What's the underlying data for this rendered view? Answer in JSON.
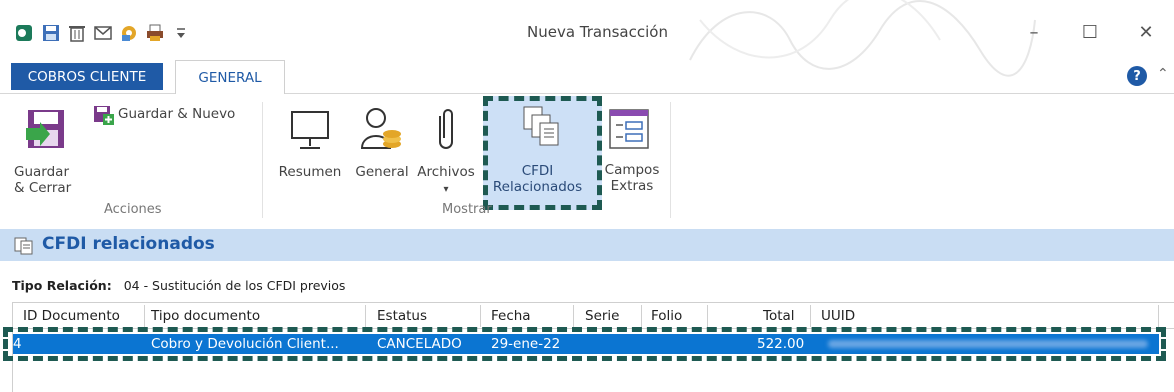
{
  "window": {
    "title": "Nueva Transacción",
    "minimize": "–",
    "maximize": "☐",
    "close": "✕"
  },
  "quick_access": [
    "app-logo-icon",
    "save-icon",
    "delete-icon",
    "email-icon",
    "tools-icon",
    "print-icon",
    "customize-icon"
  ],
  "tabs": {
    "cobros": "COBROS CLIENTE",
    "general": "GENERAL"
  },
  "help": "?",
  "ribbon": {
    "guardar_cerrar": "Guardar\n& Cerrar",
    "guardar_nuevo": "Guardar & Nuevo",
    "acciones": "Acciones",
    "resumen": "Resumen",
    "general": "General",
    "archivos": "Archivos",
    "cfdi_relacionados": "CFDI\nRelacionados",
    "campos_extras": "Campos\nExtras",
    "mostrar": "Mostrar"
  },
  "section": {
    "title": "CFDI relacionados"
  },
  "tipo_relacion": {
    "label": "Tipo Relación:",
    "value": "04 - Sustitución de los CFDI previos"
  },
  "grid": {
    "headers": {
      "id": "ID Documento",
      "tipo": "Tipo documento",
      "estatus": "Estatus",
      "fecha": "Fecha",
      "serie": "Serie",
      "folio": "Folio",
      "total": "Total",
      "uuid": "UUID"
    },
    "rows": [
      {
        "id": "4",
        "tipo": "Cobro y Devolución Client...",
        "estatus": "CANCELADO",
        "fecha": "29-ene-22",
        "serie": "",
        "folio": "",
        "total": "522.00"
      }
    ]
  },
  "colors": {
    "accent": "#1f5aa6",
    "selection": "#0b75d2",
    "section_bg": "#c9ddf3",
    "highlight_border": "#1e5a52"
  }
}
